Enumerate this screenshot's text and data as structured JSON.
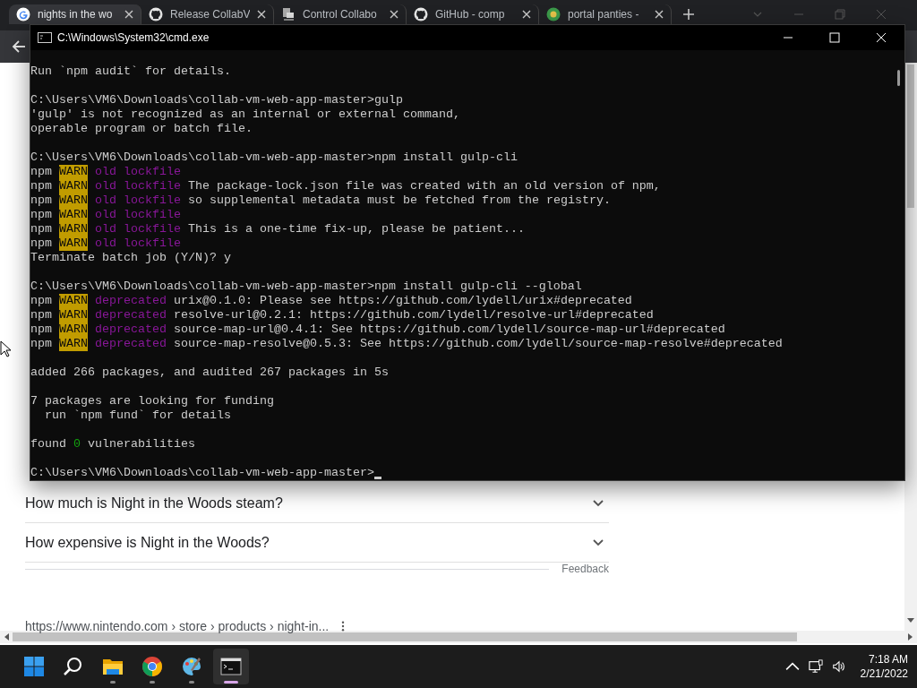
{
  "browser": {
    "tabs": [
      {
        "title": "nights in the wo",
        "kind": "google",
        "selected": true
      },
      {
        "title": "Release CollabV",
        "kind": "github",
        "selected": false
      },
      {
        "title": "Control Collabo",
        "kind": "computer",
        "selected": false
      },
      {
        "title": "GitHub - comp",
        "kind": "github",
        "selected": false
      },
      {
        "title": "portal panties -",
        "kind": "globe",
        "selected": false
      }
    ],
    "faq": [
      {
        "question": "How much is Night in the Woods steam?"
      },
      {
        "question": "How expensive is Night in the Woods?"
      }
    ],
    "feedback": "Feedback",
    "result_url": "https://www.nintendo.com › store › products › night-in..."
  },
  "console": {
    "title": "C:\\Windows\\System32\\cmd.exe",
    "cursor": true,
    "lines": [
      {
        "kind": "text",
        "segments": [
          {
            "text": "Run `npm audit` for details.",
            "kind": "plain"
          }
        ]
      },
      {
        "kind": "blank"
      },
      {
        "kind": "text",
        "segments": [
          {
            "text": "C:\\Users\\VM6\\Downloads\\collab-vm-web-app-master>gulp",
            "kind": "plain"
          }
        ]
      },
      {
        "kind": "text",
        "segments": [
          {
            "text": "'gulp' is not recognized as an internal or external command,",
            "kind": "plain"
          }
        ]
      },
      {
        "kind": "text",
        "segments": [
          {
            "text": "operable program or batch file.",
            "kind": "plain"
          }
        ]
      },
      {
        "kind": "blank"
      },
      {
        "kind": "text",
        "segments": [
          {
            "text": "C:\\Users\\VM6\\Downloads\\collab-vm-web-app-master>npm install gulp-cli",
            "kind": "plain"
          }
        ]
      },
      {
        "kind": "text",
        "segments": [
          {
            "text": "npm",
            "kind": "plain"
          },
          {
            "text": "WARN",
            "kind": "warn"
          },
          {
            "text": "old lockfile",
            "kind": "magenta"
          }
        ]
      },
      {
        "kind": "text",
        "segments": [
          {
            "text": "npm",
            "kind": "plain"
          },
          {
            "text": "WARN",
            "kind": "warn"
          },
          {
            "text": "old lockfile",
            "kind": "magenta"
          },
          {
            "text": "The package-lock.json file was created with an old version of npm,",
            "kind": "plain"
          }
        ]
      },
      {
        "kind": "text",
        "segments": [
          {
            "text": "npm",
            "kind": "plain"
          },
          {
            "text": "WARN",
            "kind": "warn"
          },
          {
            "text": "old lockfile",
            "kind": "magenta"
          },
          {
            "text": "so supplemental metadata must be fetched from the registry.",
            "kind": "plain"
          }
        ]
      },
      {
        "kind": "text",
        "segments": [
          {
            "text": "npm",
            "kind": "plain"
          },
          {
            "text": "WARN",
            "kind": "warn"
          },
          {
            "text": "old lockfile",
            "kind": "magenta"
          }
        ]
      },
      {
        "kind": "text",
        "segments": [
          {
            "text": "npm",
            "kind": "plain"
          },
          {
            "text": "WARN",
            "kind": "warn"
          },
          {
            "text": "old lockfile",
            "kind": "magenta"
          },
          {
            "text": "This is a one-time fix-up, please be patient...",
            "kind": "plain"
          }
        ]
      },
      {
        "kind": "text",
        "segments": [
          {
            "text": "npm",
            "kind": "plain"
          },
          {
            "text": "WARN",
            "kind": "warn"
          },
          {
            "text": "old lockfile",
            "kind": "magenta"
          }
        ]
      },
      {
        "kind": "text",
        "segments": [
          {
            "text": "Terminate batch job (Y/N)? y",
            "kind": "plain"
          }
        ]
      },
      {
        "kind": "blank"
      },
      {
        "kind": "text",
        "segments": [
          {
            "text": "C:\\Users\\VM6\\Downloads\\collab-vm-web-app-master>npm install gulp-cli --global",
            "kind": "plain"
          }
        ]
      },
      {
        "kind": "text",
        "segments": [
          {
            "text": "npm",
            "kind": "plain"
          },
          {
            "text": "WARN",
            "kind": "warn"
          },
          {
            "text": "deprecated",
            "kind": "magenta"
          },
          {
            "text": "urix@0.1.0: Please see https://github.com/lydell/urix#deprecated",
            "kind": "plain"
          }
        ]
      },
      {
        "kind": "text",
        "segments": [
          {
            "text": "npm",
            "kind": "plain"
          },
          {
            "text": "WARN",
            "kind": "warn"
          },
          {
            "text": "deprecated",
            "kind": "magenta"
          },
          {
            "text": "resolve-url@0.2.1: https://github.com/lydell/resolve-url#deprecated",
            "kind": "plain"
          }
        ]
      },
      {
        "kind": "text",
        "segments": [
          {
            "text": "npm",
            "kind": "plain"
          },
          {
            "text": "WARN",
            "kind": "warn"
          },
          {
            "text": "deprecated",
            "kind": "magenta"
          },
          {
            "text": "source-map-url@0.4.1: See https://github.com/lydell/source-map-url#deprecated",
            "kind": "plain"
          }
        ]
      },
      {
        "kind": "text",
        "segments": [
          {
            "text": "npm",
            "kind": "plain"
          },
          {
            "text": "WARN",
            "kind": "warn"
          },
          {
            "text": "deprecated",
            "kind": "magenta"
          },
          {
            "text": "source-map-resolve@0.5.3: See https://github.com/lydell/source-map-resolve#deprecated",
            "kind": "plain"
          }
        ]
      },
      {
        "kind": "blank"
      },
      {
        "kind": "text",
        "segments": [
          {
            "text": "added 266 packages, and audited 267 packages in 5s",
            "kind": "plain"
          }
        ]
      },
      {
        "kind": "blank"
      },
      {
        "kind": "text",
        "segments": [
          {
            "text": "7 packages are looking for funding",
            "kind": "plain"
          }
        ]
      },
      {
        "kind": "text",
        "segments": [
          {
            "text": "  run `npm fund` for details",
            "kind": "plain"
          }
        ]
      },
      {
        "kind": "blank"
      },
      {
        "kind": "text",
        "segments": [
          {
            "text": "found",
            "kind": "plain"
          },
          {
            "text": "0",
            "kind": "green"
          },
          {
            "text": "vulnerabilities",
            "kind": "plain"
          }
        ]
      },
      {
        "kind": "blank"
      },
      {
        "kind": "text",
        "segments": [
          {
            "text": "C:\\Users\\VM6\\Downloads\\collab-vm-web-app-master>",
            "kind": "plain"
          }
        ]
      }
    ]
  },
  "taskbar": {
    "apps": [
      {
        "kind": "start",
        "running": false,
        "selected": false
      },
      {
        "kind": "search",
        "running": false,
        "selected": false
      },
      {
        "kind": "folder",
        "running": true,
        "selected": false
      },
      {
        "kind": "chrome",
        "running": true,
        "selected": false
      },
      {
        "kind": "palette",
        "running": true,
        "selected": false
      },
      {
        "kind": "terminal",
        "running": true,
        "selected": true
      }
    ],
    "time": "7:18 AM",
    "date": "2/21/2022"
  }
}
